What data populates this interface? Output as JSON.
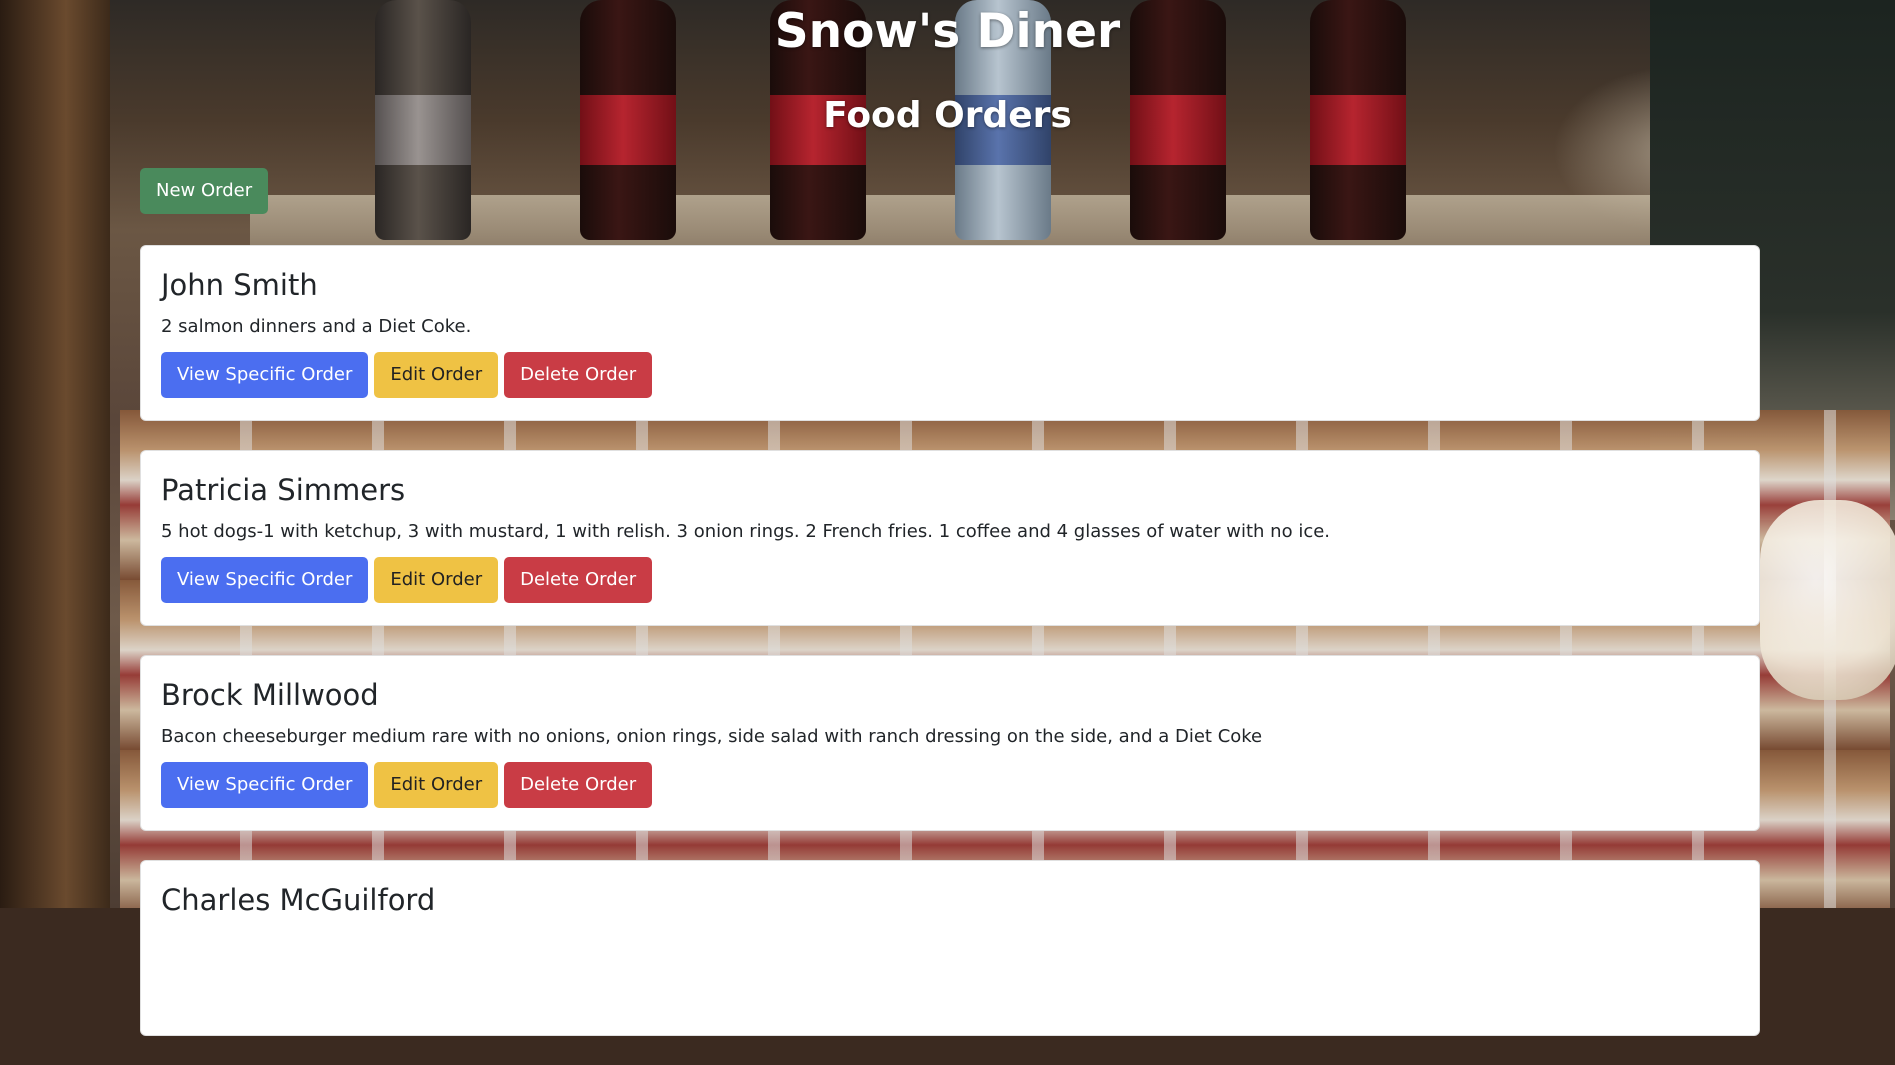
{
  "header": {
    "site_title": "Snow's Diner",
    "page_title": "Food Orders"
  },
  "toolbar": {
    "new_order_label": "New Order"
  },
  "actions": {
    "view_label": "View Specific Order",
    "edit_label": "Edit Order",
    "delete_label": "Delete Order"
  },
  "orders": [
    {
      "name": "John Smith",
      "description": "2 salmon dinners and a Diet Coke."
    },
    {
      "name": "Patricia Simmers",
      "description": "5 hot dogs-1 with ketchup, 3 with mustard, 1 with relish. 3 onion rings. 2 French fries. 1 coffee and 4 glasses of water with no ice."
    },
    {
      "name": "Brock Millwood",
      "description": "Bacon cheeseburger medium rare with no onions, onion rings, side salad with ranch dressing on the side, and a Diet Coke"
    },
    {
      "name": "Charles McGuilford",
      "description": ""
    }
  ],
  "colors": {
    "success": "#4a8a5c",
    "primary": "#4b6ef0",
    "warning": "#efc244",
    "danger": "#c93c45"
  }
}
